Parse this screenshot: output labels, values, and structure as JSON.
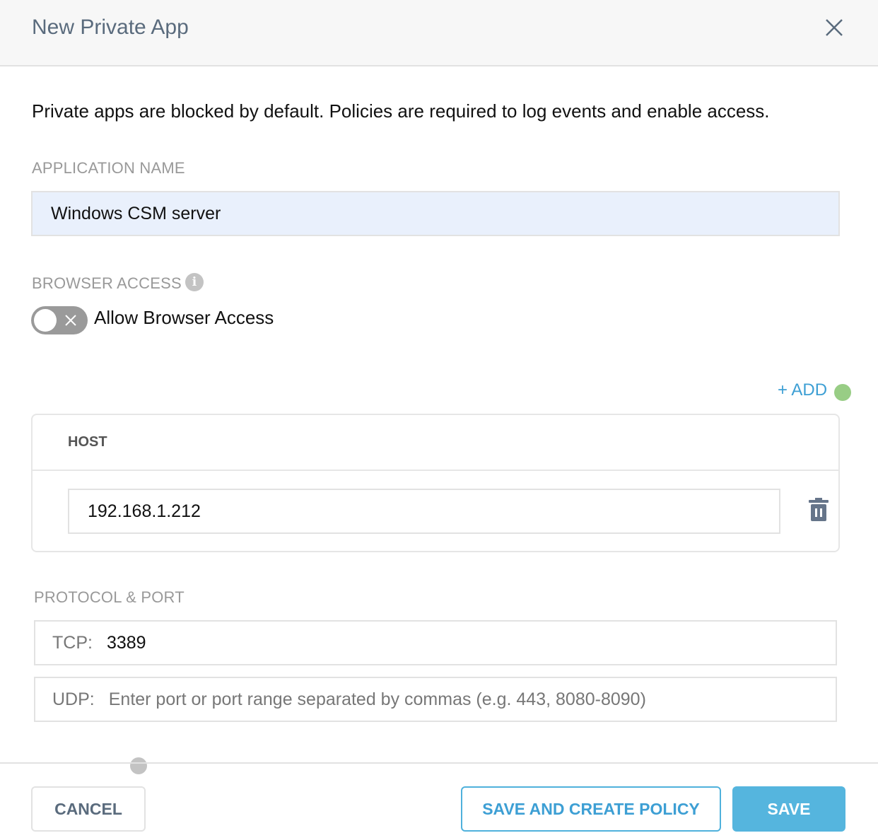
{
  "dialog": {
    "title": "New Private App",
    "description": "Private apps are blocked by default. Policies are required to log events and enable access."
  },
  "app_name": {
    "label": "APPLICATION NAME",
    "value": "Windows CSM server"
  },
  "browser_access": {
    "label": "BROWSER ACCESS",
    "info_glyph": "i",
    "toggle_label": "Allow Browser Access",
    "enabled": false
  },
  "hosts": {
    "add_label": "+ ADD",
    "column_header": "HOST",
    "rows": [
      {
        "value": "192.168.1.212"
      }
    ]
  },
  "protocol": {
    "label": "PROTOCOL & PORT",
    "tcp": {
      "prefix": "TCP:",
      "value": "3389"
    },
    "udp": {
      "prefix": "UDP:",
      "placeholder": "Enter port or port range separated by commas (e.g. 443, 8080-8090)"
    }
  },
  "footer": {
    "cancel": "CANCEL",
    "save_and_create": "SAVE AND CREATE POLICY",
    "save": "SAVE"
  },
  "colors": {
    "accent": "#3d9fd4",
    "primary_button": "#55b5de",
    "status_dot": "#98cd85"
  }
}
